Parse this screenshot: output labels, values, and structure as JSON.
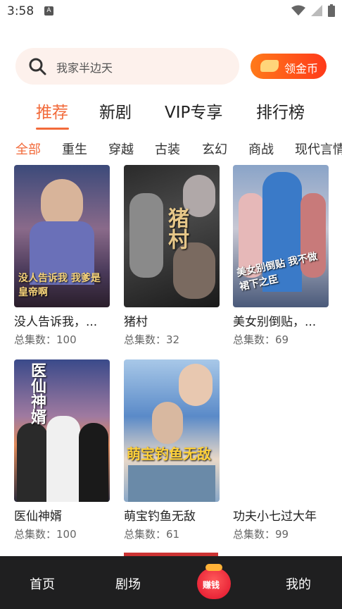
{
  "status_bar": {
    "time": "3:58",
    "notification_icon": "A"
  },
  "search": {
    "placeholder": "我家半边天",
    "icon": "search-icon"
  },
  "coin_button": {
    "label": "领金币",
    "icon": "coin-icon"
  },
  "tabs": [
    {
      "label": "推荐",
      "active": true
    },
    {
      "label": "新剧",
      "active": false
    },
    {
      "label": "VIP专享",
      "active": false
    },
    {
      "label": "排行榜",
      "active": false
    }
  ],
  "categories": [
    {
      "label": "全部",
      "active": true
    },
    {
      "label": "重生"
    },
    {
      "label": "穿越"
    },
    {
      "label": "古装"
    },
    {
      "label": "玄幻"
    },
    {
      "label": "商战"
    },
    {
      "label": "现代言情"
    }
  ],
  "dramas": [
    {
      "title": "没人告诉我，...",
      "count": "总集数：100",
      "poster_text": "没人告诉我 我爹是皇帝啊"
    },
    {
      "title": "猪村",
      "count": "总集数：32",
      "poster_text": "猪村"
    },
    {
      "title": "美女别倒贴，...",
      "count": "总集数：69",
      "poster_text": "美女别倒贴 我不做裙下之臣"
    },
    {
      "title": "医仙神婿",
      "count": "总集数：100",
      "poster_text": "医仙神婿"
    },
    {
      "title": "萌宝钓鱼无敌",
      "count": "总集数：61",
      "poster_text": "萌宝钓鱼无敌"
    },
    {
      "title": "功夫小七过大年",
      "count": "总集数：99",
      "poster_text": ""
    }
  ],
  "bottom_nav": {
    "home": "首页",
    "theater": "剧场",
    "earn": "赚钱",
    "mine": "我的"
  },
  "colors": {
    "accent": "#f26a3a",
    "nav_bg": "#1f1f20"
  }
}
